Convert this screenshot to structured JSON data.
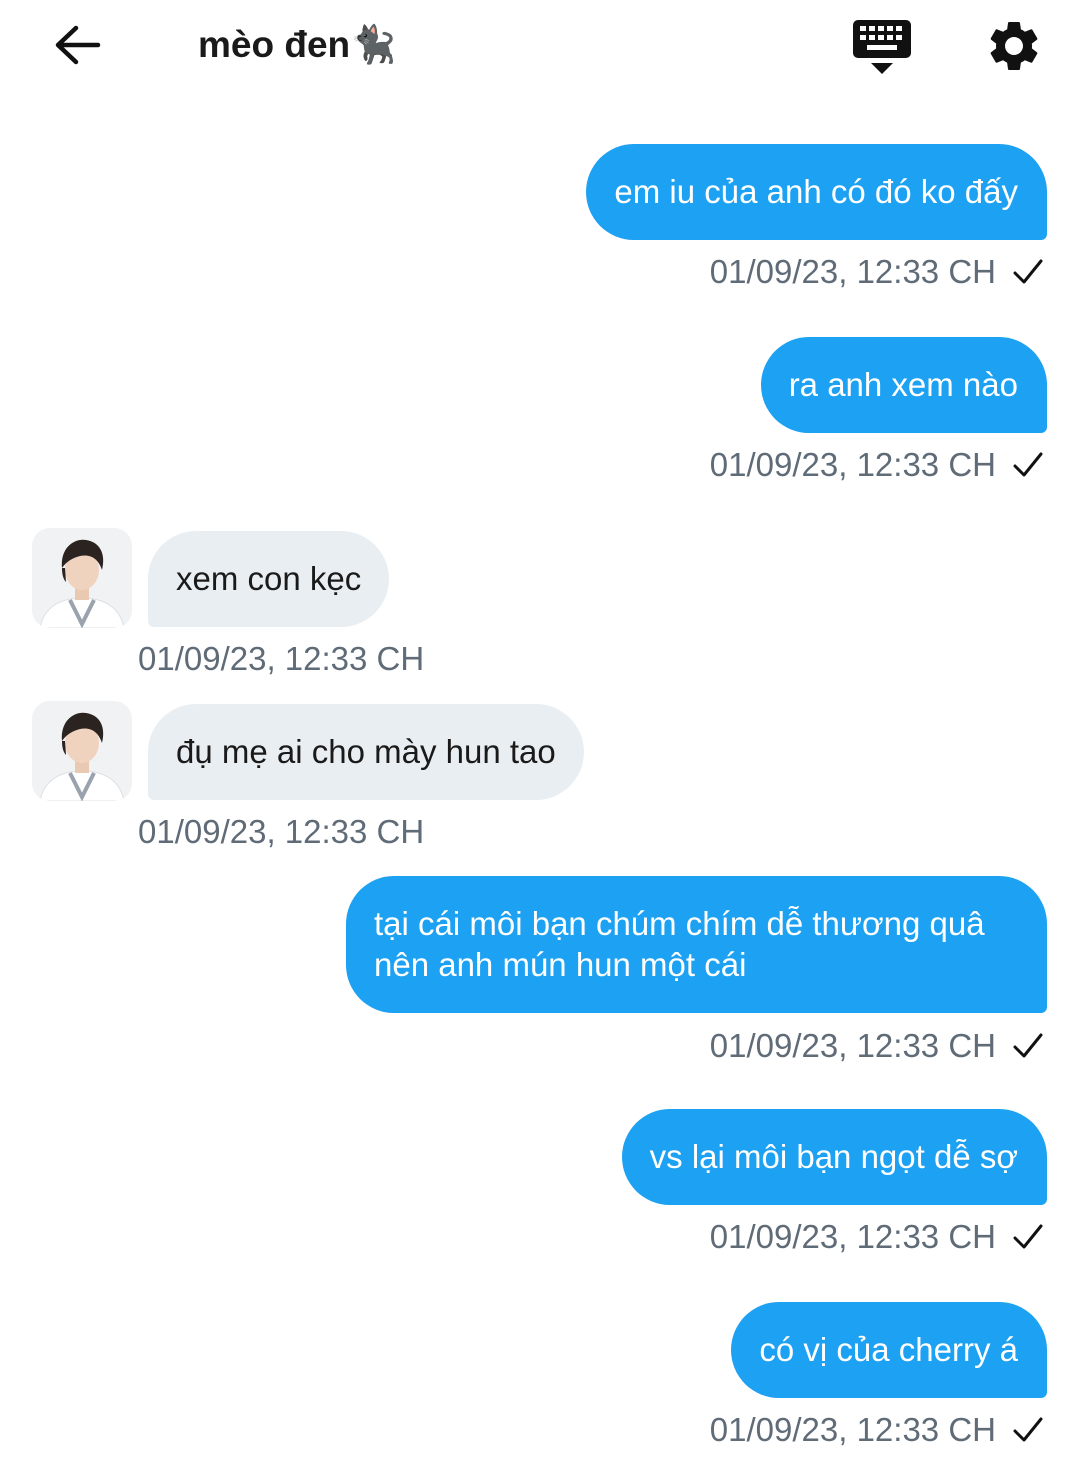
{
  "header": {
    "title": "mèo đen",
    "title_emoji": "🐈‍⬛",
    "back_icon": "arrow-left-icon",
    "keyboard_icon": "keyboard-icon",
    "settings_icon": "gear-icon"
  },
  "colors": {
    "outgoing_bubble": "#1da1f2",
    "incoming_bubble": "#e9eef2",
    "timestamp": "#5f6b77"
  },
  "messages": [
    {
      "direction": "outgoing",
      "text": "em iu của anh có đó ko đấy",
      "time": "01/09/23, 12:33 CH",
      "status_icon": "check-icon"
    },
    {
      "direction": "outgoing",
      "text": "ra anh xem nào",
      "time": "01/09/23, 12:33 CH",
      "status_icon": "check-icon"
    },
    {
      "direction": "incoming",
      "text": "xem con kẹc",
      "time": "01/09/23, 12:33 CH",
      "avatar": "avatar"
    },
    {
      "direction": "incoming",
      "text": "đụ mẹ ai cho mày hun tao",
      "time": "01/09/23, 12:33 CH",
      "avatar": "avatar"
    },
    {
      "direction": "outgoing",
      "text": "tại cái môi bạn chúm chím dễ thương quâ nên anh mún hun một cái",
      "time": "01/09/23, 12:33 CH",
      "status_icon": "check-icon"
    },
    {
      "direction": "outgoing",
      "text": "vs lại môi bạn ngọt dễ sợ",
      "time": "01/09/23, 12:33 CH",
      "status_icon": "check-icon"
    },
    {
      "direction": "outgoing",
      "text": "có vị của cherry á",
      "time": "01/09/23, 12:33 CH",
      "status_icon": "check-icon"
    }
  ]
}
